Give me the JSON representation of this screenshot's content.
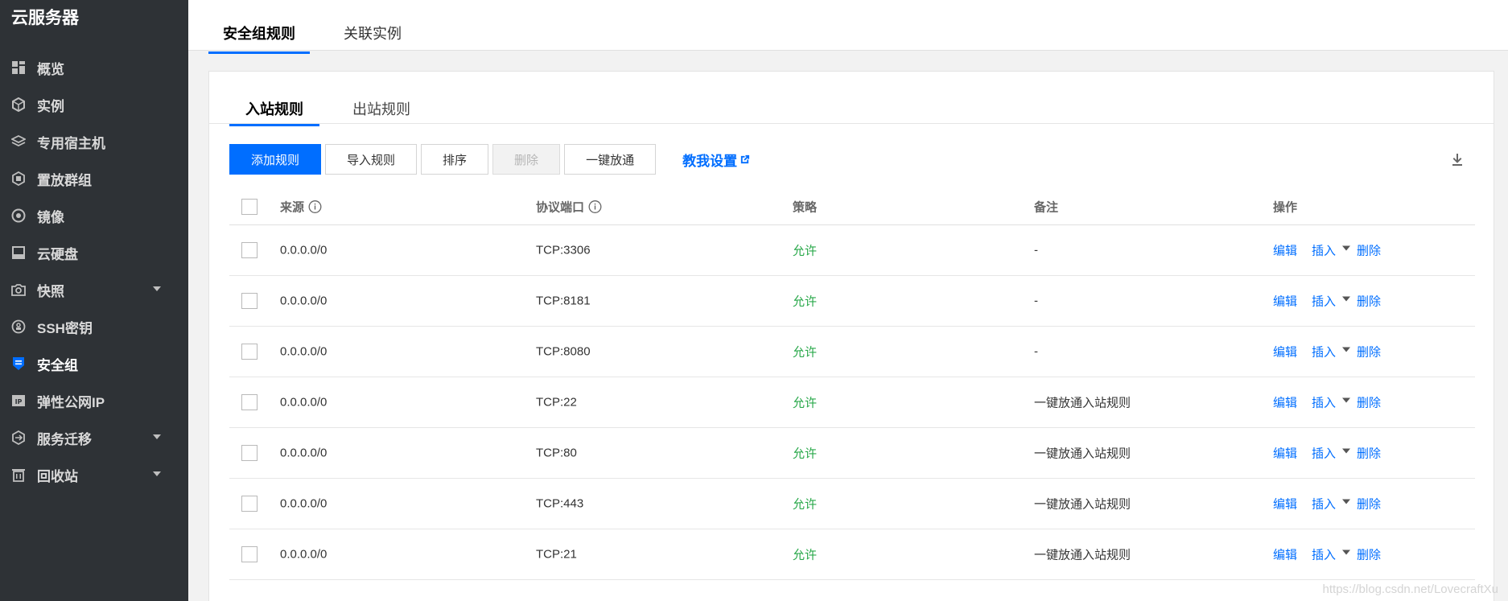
{
  "sidebar": {
    "title": "云服务器",
    "items": [
      {
        "label": "概览",
        "icon": "grid-icon",
        "active": false,
        "caret": false
      },
      {
        "label": "实例",
        "icon": "cube-icon",
        "active": false,
        "caret": false
      },
      {
        "label": "专用宿主机",
        "icon": "layers-icon",
        "active": false,
        "caret": false
      },
      {
        "label": "置放群组",
        "icon": "placement-icon",
        "active": false,
        "caret": false
      },
      {
        "label": "镜像",
        "icon": "disc-icon",
        "active": false,
        "caret": false
      },
      {
        "label": "云硬盘",
        "icon": "disk-icon",
        "active": false,
        "caret": false
      },
      {
        "label": "快照",
        "icon": "camera-icon",
        "active": false,
        "caret": true
      },
      {
        "label": "SSH密钥",
        "icon": "key-icon",
        "active": false,
        "caret": false
      },
      {
        "label": "安全组",
        "icon": "shield-icon",
        "active": true,
        "caret": false
      },
      {
        "label": "弹性公网IP",
        "icon": "ip-icon",
        "active": false,
        "caret": false
      },
      {
        "label": "服务迁移",
        "icon": "migrate-icon",
        "active": false,
        "caret": true
      },
      {
        "label": "回收站",
        "icon": "trash-icon",
        "active": false,
        "caret": true
      }
    ]
  },
  "top_tabs": {
    "tab1": "安全组规则",
    "tab2": "关联实例"
  },
  "sub_tabs": {
    "inbound": "入站规则",
    "outbound": "出站规则"
  },
  "toolbar": {
    "add": "添加规则",
    "import": "导入规则",
    "sort": "排序",
    "delete": "删除",
    "open_all": "一键放通",
    "help": "教我设置"
  },
  "table": {
    "headers": {
      "source": "来源",
      "port": "协议端口",
      "policy": "策略",
      "note": "备注",
      "ops": "操作"
    },
    "ops": {
      "edit": "编辑",
      "insert": "插入",
      "delete": "删除"
    },
    "rows": [
      {
        "source": "0.0.0.0/0",
        "port": "TCP:3306",
        "policy": "允许",
        "note": "-"
      },
      {
        "source": "0.0.0.0/0",
        "port": "TCP:8181",
        "policy": "允许",
        "note": "-"
      },
      {
        "source": "0.0.0.0/0",
        "port": "TCP:8080",
        "policy": "允许",
        "note": "-"
      },
      {
        "source": "0.0.0.0/0",
        "port": "TCP:22",
        "policy": "允许",
        "note": "一键放通入站规则"
      },
      {
        "source": "0.0.0.0/0",
        "port": "TCP:80",
        "policy": "允许",
        "note": "一键放通入站规则"
      },
      {
        "source": "0.0.0.0/0",
        "port": "TCP:443",
        "policy": "允许",
        "note": "一键放通入站规则"
      },
      {
        "source": "0.0.0.0/0",
        "port": "TCP:21",
        "policy": "允许",
        "note": "一键放通入站规则"
      }
    ]
  },
  "watermark": "https://blog.csdn.net/LovecraftXu",
  "colors": {
    "sidebar_bg": "#2e3236",
    "accent": "#006eff",
    "allow": "#29a84a"
  }
}
